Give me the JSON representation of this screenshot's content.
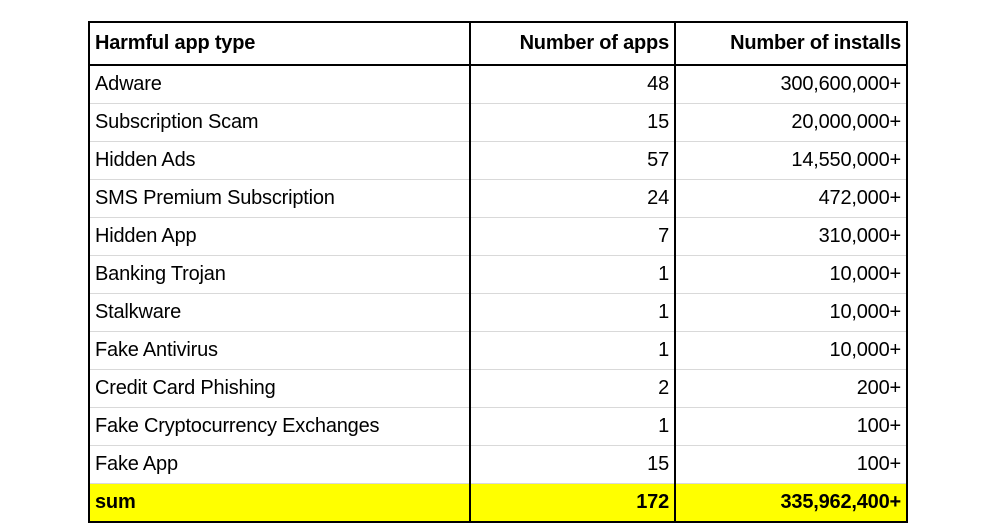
{
  "table": {
    "columns": [
      {
        "key": "type",
        "label": "Harmful app type",
        "align": "left"
      },
      {
        "key": "apps",
        "label": "Number of apps",
        "align": "right"
      },
      {
        "key": "installs",
        "label": "Number of installs",
        "align": "right"
      }
    ],
    "rows": [
      {
        "type": "Adware",
        "apps": "48",
        "installs": "300,600,000+"
      },
      {
        "type": "Subscription Scam",
        "apps": "15",
        "installs": "20,000,000+"
      },
      {
        "type": "Hidden Ads",
        "apps": "57",
        "installs": "14,550,000+"
      },
      {
        "type": "SMS Premium Subscription",
        "apps": "24",
        "installs": "472,000+"
      },
      {
        "type": "Hidden App",
        "apps": "7",
        "installs": "310,000+"
      },
      {
        "type": "Banking Trojan",
        "apps": "1",
        "installs": "10,000+"
      },
      {
        "type": "Stalkware",
        "apps": "1",
        "installs": "10,000+"
      },
      {
        "type": "Fake Antivirus",
        "apps": "1",
        "installs": "10,000+"
      },
      {
        "type": "Credit Card Phishing",
        "apps": "2",
        "installs": "200+"
      },
      {
        "type": "Fake Cryptocurrency Exchanges",
        "apps": "1",
        "installs": "100+"
      },
      {
        "type": "Fake App",
        "apps": "15",
        "installs": "100+"
      }
    ],
    "summary_row": {
      "type": "sum",
      "apps": "172",
      "installs": "335,962,400+",
      "highlight_color": "#FFFF00"
    },
    "colors": {
      "border": "#000000",
      "gridline": "#D9D9D9",
      "background": "#FFFFFF",
      "text": "#000000",
      "summary_highlight": "#FFFF00"
    }
  },
  "chart_data": {
    "type": "table",
    "title": "",
    "columns": [
      "Harmful app type",
      "Number of apps",
      "Number of installs"
    ],
    "categories": [
      "Adware",
      "Subscription Scam",
      "Hidden Ads",
      "SMS Premium Subscription",
      "Hidden App",
      "Banking Trojan",
      "Stalkware",
      "Fake Antivirus",
      "Credit Card Phishing",
      "Fake Cryptocurrency Exchanges",
      "Fake App"
    ],
    "series": [
      {
        "name": "Number of apps",
        "values": [
          48,
          15,
          57,
          24,
          7,
          1,
          1,
          1,
          2,
          1,
          15
        ],
        "total": 172
      },
      {
        "name": "Number of installs",
        "values": [
          300600000,
          20000000,
          14550000,
          472000,
          310000,
          10000,
          10000,
          10000,
          200,
          100,
          100
        ],
        "total": 335962400,
        "note": "values displayed with a trailing + (minimum install counts)"
      }
    ],
    "summary_label": "sum"
  }
}
